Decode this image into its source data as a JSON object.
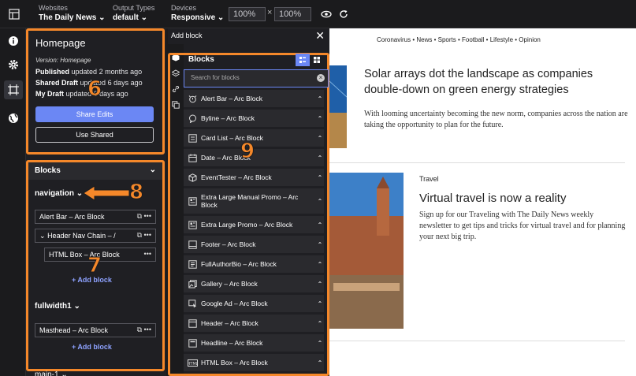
{
  "topbar": {
    "websites_label": "Websites",
    "websites_value": "The Daily News",
    "output_label": "Output Types",
    "output_value": "default",
    "devices_label": "Devices",
    "devices_value": "Responsive",
    "width_value": "100%",
    "times": "×",
    "height_value": "100%"
  },
  "rail": [
    "info-icon",
    "gear-icon",
    "frame-icon",
    "globe-icon"
  ],
  "homepage": {
    "title": "Homepage",
    "version": "Version: Homepage",
    "published_label": "Published",
    "published_text": "updated 2 months ago",
    "shared_label": "Shared Draft",
    "shared_text": "updated 6 days ago",
    "mydraft_label": "My Draft",
    "mydraft_text": "updated 6 days ago",
    "share_button": "Share Edits",
    "use_shared_button": "Use Shared"
  },
  "blocks_panel": {
    "header": "Blocks",
    "section_navigation": "navigation",
    "nav_items": [
      "Alert Bar – Arc Block",
      "Header Nav Chain – /",
      "HTML Box – Arc Block"
    ],
    "add_block": "+ Add block",
    "section_fullwidth": "fullwidth1",
    "fullwidth_items": [
      "Masthead – Arc Block"
    ],
    "section_main": "main-1"
  },
  "add_block_panel": {
    "title": "Add block",
    "blocks_title": "Blocks",
    "search_placeholder": "Search for blocks",
    "items": [
      "Alert Bar – Arc Block",
      "Byline – Arc Block",
      "Card List – Arc Block",
      "Date – Arc Block",
      "EventTester – Arc Block",
      "Extra Large Manual Promo – Arc Block",
      "Extra Large Promo – Arc Block",
      "Footer – Arc Block",
      "FullAuthorBio – Arc Block",
      "Gallery – Arc Block",
      "Google Ad – Arc Block",
      "Header – Arc Block",
      "Headline – Arc Block",
      "HTML Box – Arc Block"
    ]
  },
  "preview": {
    "nav": "Coronavirus • News • Sports • Football • Lifestyle • Opinion",
    "story1_title": "Solar arrays dot the landscape as companies double-down on green energy strategies",
    "story1_body": "With looming uncertainty becoming the new norm, companies across the nation are taking the opportunity to plan for the future.",
    "story2_tag": "Travel",
    "story2_title": "Virtual travel is now a reality",
    "story2_body": "Sign up for our Traveling with The Daily News weekly newsletter to get tips and tricks for virtual travel and for planning your next big trip."
  },
  "callouts": [
    "6",
    "7",
    "8",
    "9"
  ],
  "colors": {
    "accent_orange": "#f5882a",
    "button_blue": "#6b87f4",
    "panel_dark": "#1f1f23"
  }
}
